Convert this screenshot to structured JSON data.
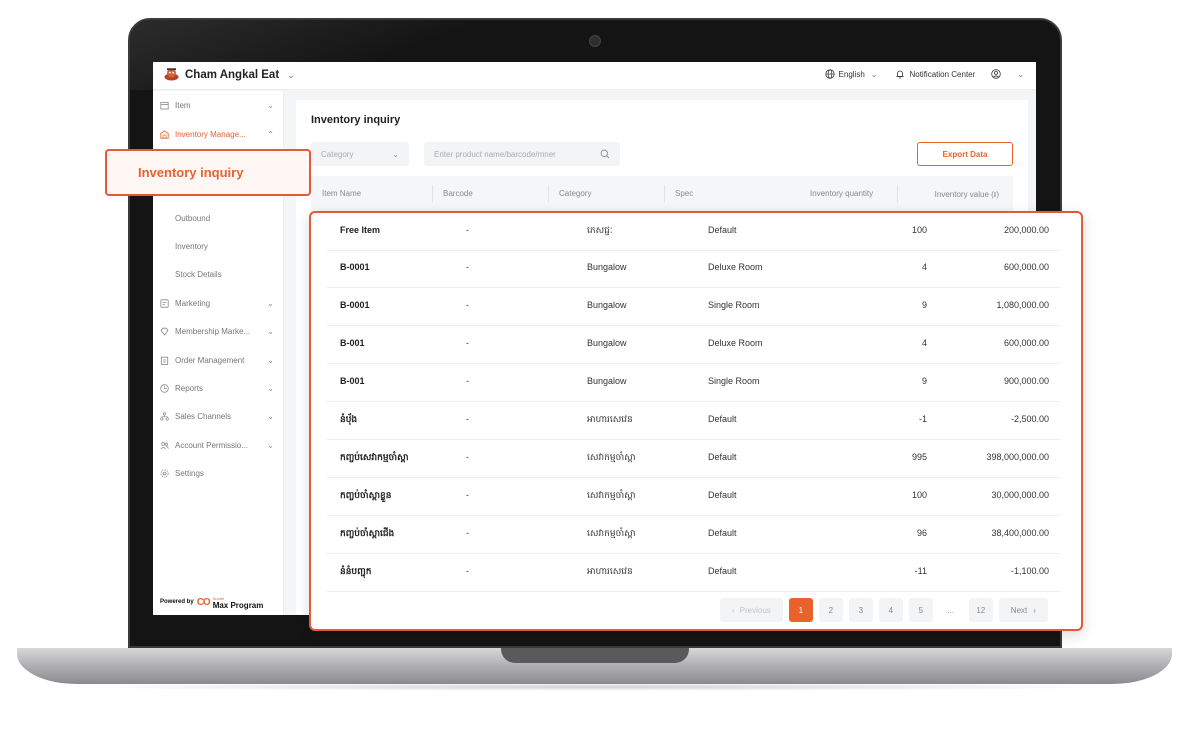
{
  "brand": {
    "name": "Cham Angkal Eat",
    "accent": "#e8622c"
  },
  "topbar": {
    "language": "English",
    "notifications": "Notification Center"
  },
  "sidebar": {
    "items": [
      {
        "label": "Item"
      },
      {
        "label": "Inventory Manage..."
      },
      {
        "label": "Marketing"
      },
      {
        "label": "Membership Marke..."
      },
      {
        "label": "Order Management"
      },
      {
        "label": "Reports"
      },
      {
        "label": "Sales Channels"
      },
      {
        "label": "Account Permissio..."
      },
      {
        "label": "Settings"
      }
    ],
    "sub_items": [
      {
        "label": "Outbound"
      },
      {
        "label": "Inventory"
      },
      {
        "label": "Stock Details"
      }
    ],
    "powered_by": "Powered by",
    "powered_brand": "Max Program",
    "powered_small": "Sunmi"
  },
  "page": {
    "title": "Inventory inquiry",
    "category_placeholder": "Category",
    "search_placeholder": "Enter product name/barcode/mner",
    "export_label": "Export Data"
  },
  "table": {
    "columns": [
      "Item Name",
      "Barcode",
      "Category",
      "Spec",
      "Inventory quantity",
      "Inventory value (៛)"
    ],
    "rows": [
      {
        "name": "Free Item",
        "barcode": "-",
        "category": "ភេសជ្ជៈ",
        "spec": "Default",
        "qty": "100",
        "value": "200,000.00"
      },
      {
        "name": "B-0001",
        "barcode": "-",
        "category": "Bungalow",
        "spec": "Deluxe Room",
        "qty": "4",
        "value": "600,000.00"
      },
      {
        "name": "B-0001",
        "barcode": "-",
        "category": "Bungalow",
        "spec": "Single Room",
        "qty": "9",
        "value": "1,080,000.00"
      },
      {
        "name": "B-001",
        "barcode": "-",
        "category": "Bungalow",
        "spec": "Deluxe Room",
        "qty": "4",
        "value": "600,000.00"
      },
      {
        "name": "B-001",
        "barcode": "-",
        "category": "Bungalow",
        "spec": "Single Room",
        "qty": "9",
        "value": "900,000.00"
      },
      {
        "name": "នំប៉័ង",
        "barcode": "-",
        "category": "អាហារសេវេន",
        "spec": "Default",
        "qty": "-1",
        "value": "-2,500.00"
      },
      {
        "name": "កញ្ចប់សេវាកម្មចាំស្ពា",
        "barcode": "-",
        "category": "សេវាកម្មចាំស្ពា",
        "spec": "Default",
        "qty": "995",
        "value": "398,000,000.00"
      },
      {
        "name": "កញ្ចប់ចាំស្ពាខ្លួន",
        "barcode": "-",
        "category": "សេវាកម្មចាំស្ពា",
        "spec": "Default",
        "qty": "100",
        "value": "30,000,000.00"
      },
      {
        "name": "កញ្ចប់ចាំស្ពាជើង",
        "barcode": "-",
        "category": "សេវាកម្មចាំស្ពា",
        "spec": "Default",
        "qty": "96",
        "value": "38,400,000.00"
      },
      {
        "name": "នំនំបញ្ជុក",
        "barcode": "-",
        "category": "អាហារសេវេន",
        "spec": "Default",
        "qty": "-11",
        "value": "-1,100.00"
      }
    ]
  },
  "pagination": {
    "previous": "Previous",
    "next": "Next",
    "pages": [
      "1",
      "2",
      "3",
      "4",
      "5",
      "...",
      "12"
    ],
    "current": "1"
  },
  "callout": {
    "label": "Inventory inquiry",
    "color": "#e35a3a"
  }
}
